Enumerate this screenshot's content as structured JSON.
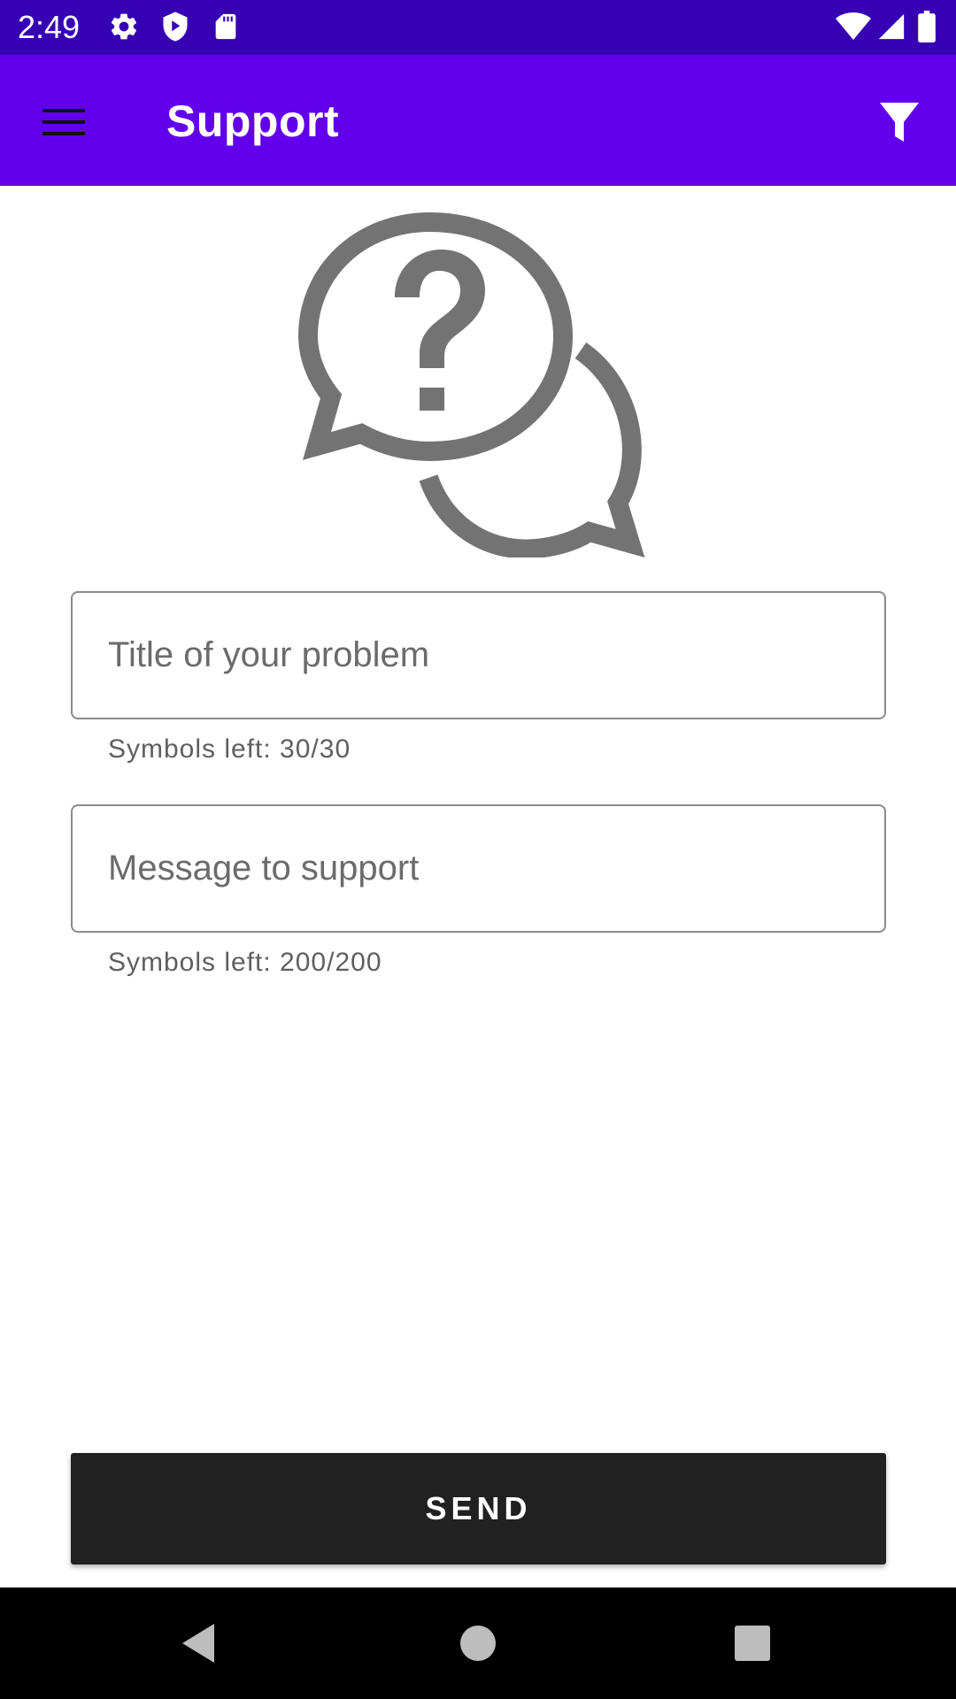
{
  "status_bar": {
    "time": "2:49",
    "icons": [
      "settings-icon",
      "shield-play-icon",
      "sd-card-icon",
      "wifi-icon",
      "cell-signal-icon",
      "battery-icon"
    ]
  },
  "app_bar": {
    "title": "Support",
    "menu_icon": "menu-icon",
    "filter_icon": "filter-icon",
    "background_color": "#6200ee"
  },
  "hero": {
    "icon": "question-chat-icon",
    "color": "#737373"
  },
  "form": {
    "title_field": {
      "placeholder": "Title of your problem",
      "value": "",
      "helper": "Symbols left: 30/30"
    },
    "message_field": {
      "placeholder": "Message to support",
      "value": "",
      "helper": "Symbols left: 200/200"
    }
  },
  "send_button": {
    "label": "SEND",
    "color": "#212121"
  },
  "nav_bar": {
    "icons": [
      "back-icon",
      "home-icon",
      "recents-icon"
    ]
  }
}
